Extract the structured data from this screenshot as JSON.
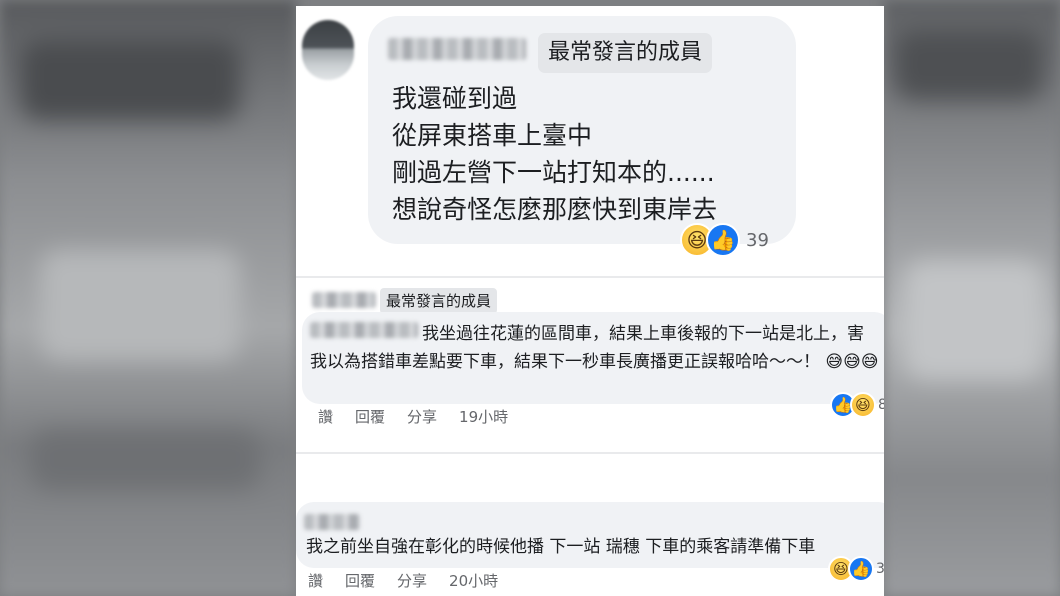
{
  "comments": [
    {
      "badge": "最常發言的成員",
      "body": "我還碰到過\n從屏東搭車上臺中\n剛過左營下一站打知本的......\n想說奇怪怎麼那麼快到東岸去",
      "reactions": [
        "haha",
        "like"
      ],
      "reaction_count": "39"
    },
    {
      "badge": "最常發言的成員",
      "body": "我坐過往花蓮的區間車，結果上車後報的下一站是北上，害我以為搭錯車差點要下車，結果下一秒車長廣播更正誤報哈哈～～！",
      "emojis": "😅😅😅",
      "actions": {
        "like": "讚",
        "reply": "回覆",
        "share": "分享",
        "time": "19小時"
      },
      "reactions": [
        "like",
        "haha"
      ],
      "reaction_count": "8"
    },
    {
      "body": "我之前坐自強在彰化的時候他播 下一站 瑞穗 下車的乘客請準備下車",
      "actions": {
        "like": "讚",
        "reply": "回覆",
        "share": "分享",
        "time": "20小時"
      },
      "reactions": [
        "haha",
        "like"
      ],
      "reaction_count": "3"
    }
  ],
  "colors": {
    "bubble": "#f0f2f5",
    "badge": "#e4e6e9",
    "text": "#1c1e21",
    "secondary": "#65676b",
    "like_blue": "#1877f2",
    "haha_yellow": "#f7b125"
  },
  "icons": {
    "like": "thumbs-up-icon",
    "haha": "laughing-face-icon"
  }
}
